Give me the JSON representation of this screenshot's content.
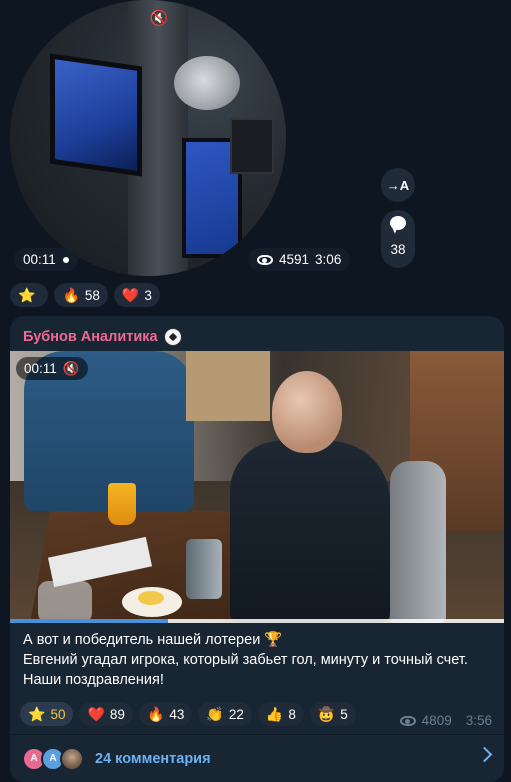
{
  "post1": {
    "video_duration": "00:11",
    "views": "4591",
    "time": "3:06",
    "share_label": "→A",
    "comments_count": "38",
    "reactions": [
      {
        "icon": "star-emoji",
        "emoji": "⭐",
        "count": ""
      },
      {
        "icon": "fire-emoji",
        "emoji": "🔥",
        "count": "58"
      },
      {
        "icon": "heart-emoji",
        "emoji": "❤️",
        "count": "3"
      }
    ]
  },
  "post2": {
    "author": "Бубнов Аналитика",
    "video_duration": "00:11",
    "video_progress": 0.32,
    "caption_line1": "А вот и победитель нашей лотереи 🏆",
    "caption_line2": "Евгений угадал игрока, который забьет гол, минуту и точный счет. Наши поздравления!",
    "reactions": [
      {
        "icon": "star-emoji",
        "emoji": "⭐",
        "count": "50",
        "active": true
      },
      {
        "icon": "heart-emoji",
        "emoji": "❤️",
        "count": "89"
      },
      {
        "icon": "fire-emoji",
        "emoji": "🔥",
        "count": "43"
      },
      {
        "icon": "clap-emoji",
        "emoji": "👏",
        "count": "22"
      },
      {
        "icon": "thumbs-up-emoji",
        "emoji": "👍",
        "count": "8"
      },
      {
        "icon": "cowboy-emoji",
        "emoji": "🤠",
        "count": "5"
      }
    ],
    "views": "4809",
    "time": "3:56",
    "comments_label": "24 комментария",
    "avatars": [
      "A",
      "A",
      ""
    ]
  },
  "colors": {
    "background": "#0e1621",
    "bubble": "#182533",
    "author": "#f06995",
    "link": "#6ab2f2",
    "meta": "#6d7f8f"
  }
}
